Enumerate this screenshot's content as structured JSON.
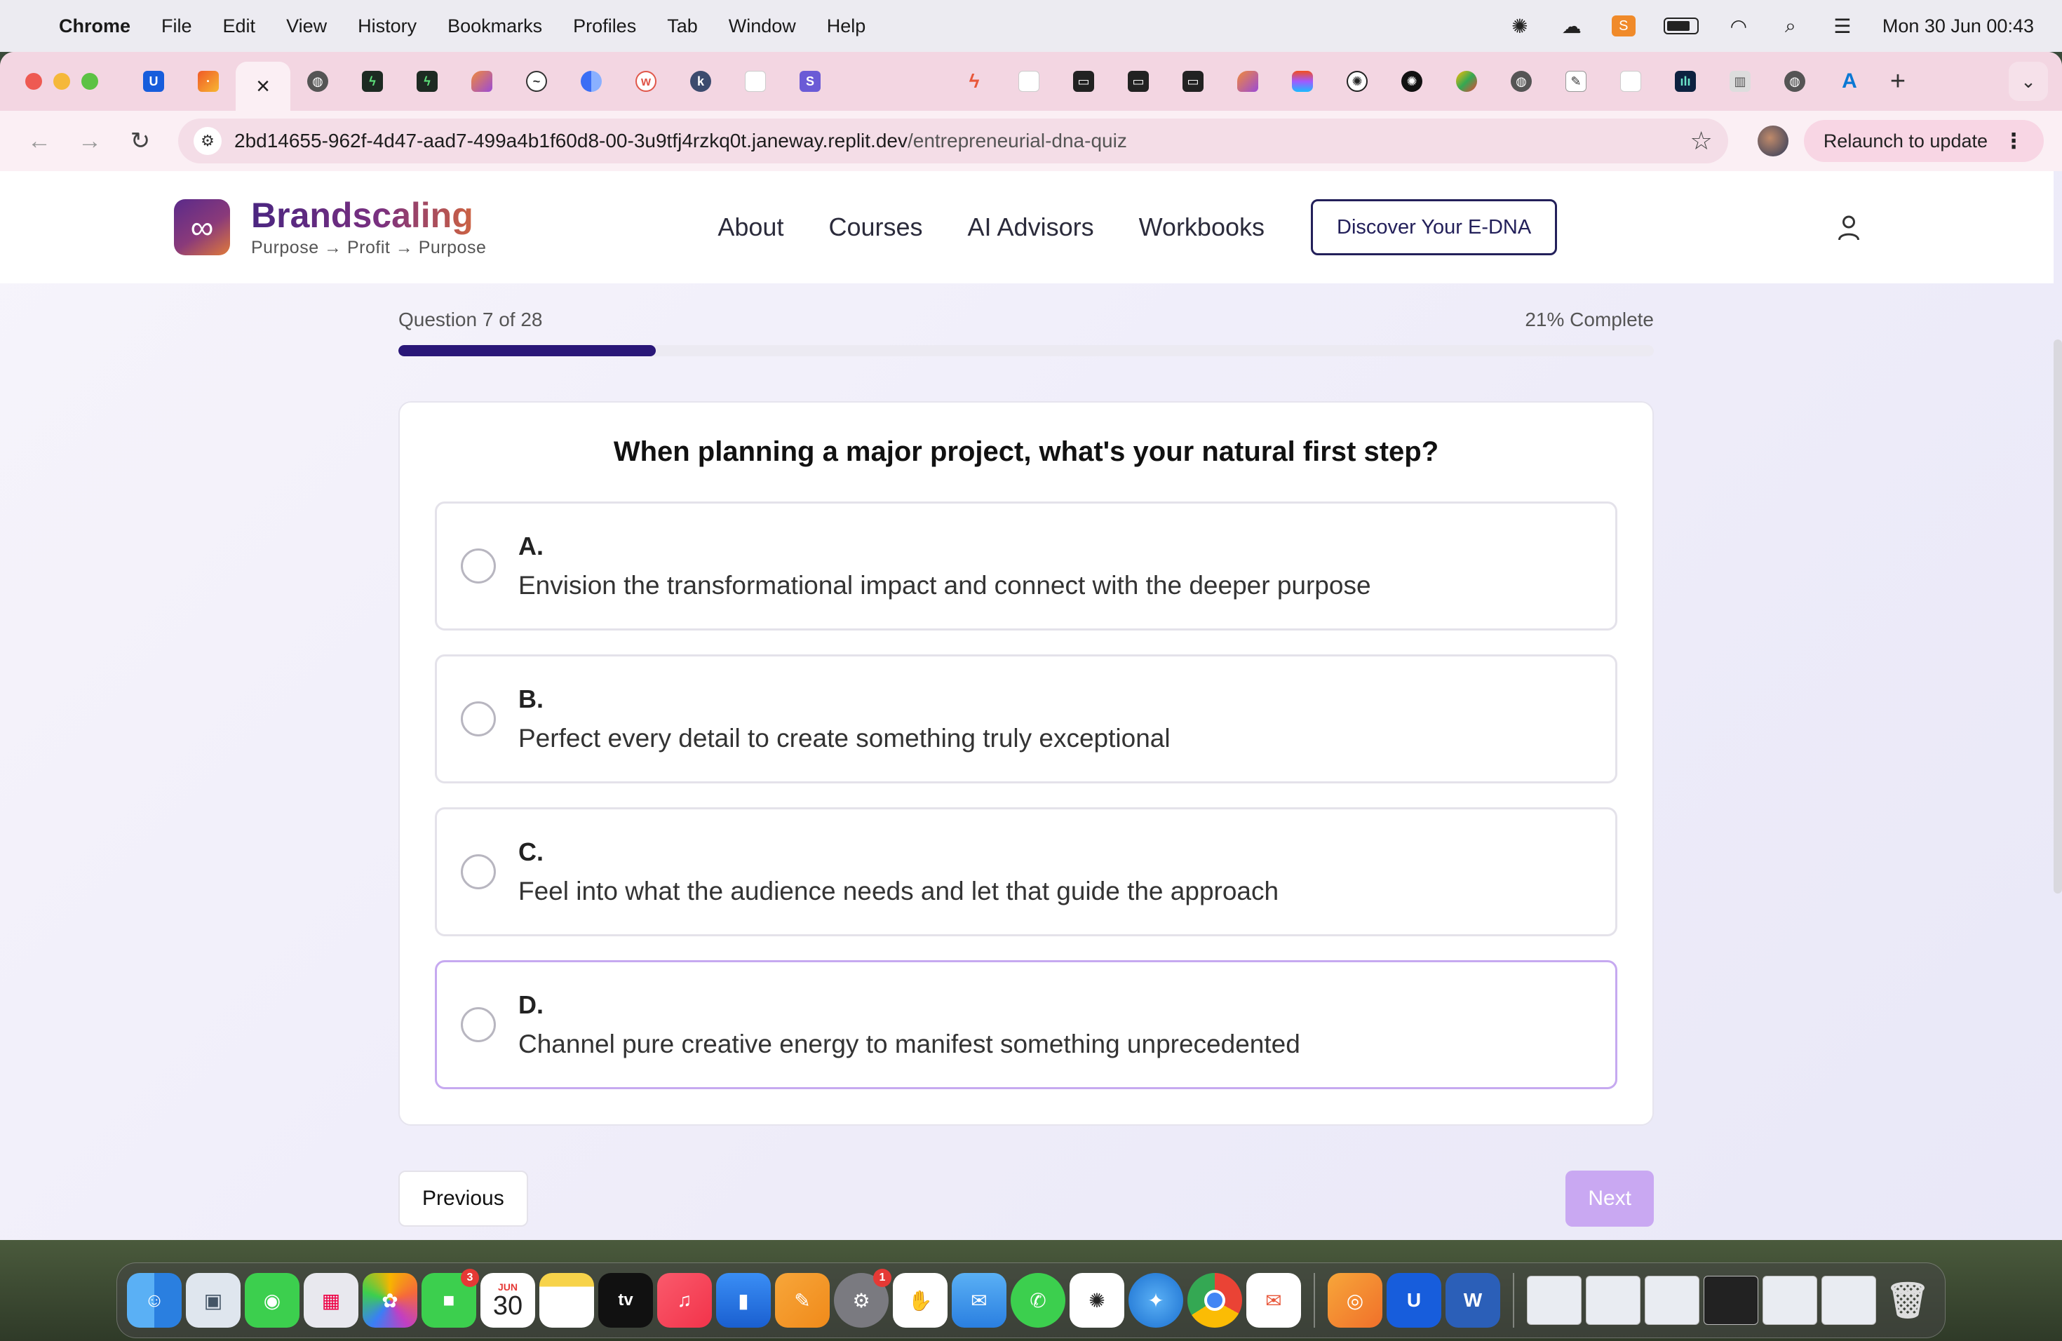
{
  "menubar": {
    "app_name": "Chrome",
    "items": [
      "File",
      "Edit",
      "View",
      "History",
      "Bookmarks",
      "Profiles",
      "Tab",
      "Window",
      "Help"
    ],
    "clock": "Mon 30 Jun  00:43"
  },
  "browser": {
    "url_host": "2bd14655-962f-4d47-aad7-499a4b1f60d8-00-3u9tfj4rzkq0t.janeway.replit.dev",
    "url_path": "/entrepreneurial-dna-quiz",
    "relaunch_label": "Relaunch to update",
    "tab_icons": [
      "bitwarden-icon",
      "multi-color-icon",
      "close-icon",
      "globe-icon",
      "bolt-icon",
      "bolt-icon",
      "shape-icon",
      "chart-icon",
      "split-icon",
      "w-icon",
      "k-icon",
      "doc-icon",
      "s-icon",
      "blank-icon",
      "blank-icon",
      "zap-icon",
      "doc-icon",
      "box-icon",
      "box-icon",
      "box-icon",
      "shape-icon",
      "figma-icon",
      "openai-icon",
      "openai-icon",
      "maps-icon",
      "globe-icon",
      "edit-icon",
      "doc-icon",
      "bars-icon",
      "chart-icon",
      "globe-icon",
      "azure-icon"
    ]
  },
  "site": {
    "brand_name": "Brandscaling",
    "tagline": "Purpose → Profit → Purpose",
    "logo_symbol": "∞",
    "nav": [
      "About",
      "Courses",
      "AI Advisors",
      "Workbooks"
    ],
    "cta_label": "Discover Your E-DNA"
  },
  "quiz": {
    "question_counter": "Question 7 of 28",
    "percent_label": "21% Complete",
    "progress_fraction": 0.205,
    "question": "When planning a major project, what's your natural first step?",
    "options": [
      {
        "letter": "A.",
        "text": "Envision the transformational impact and connect with the deeper purpose"
      },
      {
        "letter": "B.",
        "text": "Perfect every detail to create something truly exceptional"
      },
      {
        "letter": "C.",
        "text": "Feel into what the audience needs and let that guide the approach"
      },
      {
        "letter": "D.",
        "text": "Channel pure creative energy to manifest something unprecedented"
      }
    ],
    "previous_label": "Previous",
    "next_label": "Next"
  },
  "colors": {
    "accent": "#2a1778",
    "next_disabled": "#c9a8f2",
    "hover_border": "#c6a9f0"
  },
  "dock": {
    "calendar_month": "JUN",
    "calendar_day": "30",
    "facetime_badge": "3",
    "settings_badge": "1"
  }
}
